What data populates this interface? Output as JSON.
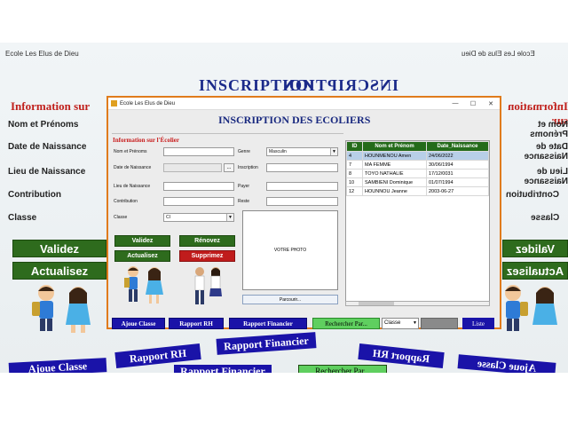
{
  "background": {
    "app_title": "Ecole Les Elus de Dieu",
    "heading": "INSCRIPTION",
    "info_heading": "Information sur",
    "labels": [
      "Nom et Prénoms",
      "Date de Naissance",
      "Lieu de Naissance",
      "Contribution",
      "Classe"
    ],
    "buttons": {
      "valider": "Validez",
      "actualiser": "Actualisez"
    },
    "bottom_buttons": [
      "Ajoue Classe",
      "Rapport RH",
      "Rapport Financier",
      "Rechercher Par...",
      "Classe"
    ]
  },
  "window": {
    "title": "Ecole Les Elus de Dieu",
    "controls": {
      "minimize": "—",
      "maximize": "☐",
      "close": "✕"
    },
    "heading": "INSCRIPTION DES ECOLIERS",
    "group_legend": "Information sur l'Écolier",
    "form": {
      "nom_label": "Nom et Prénoms",
      "nom_value": "",
      "date_label": "Date de Naissance",
      "date_value": "",
      "date_button": "...",
      "lieu_label": "Lieu de Naissance",
      "lieu_value": "",
      "contribution_label": "Contribution",
      "contribution_value": "",
      "classe_label": "Classe",
      "classe_value": "CI",
      "genre_label": "Genre",
      "genre_value": "Masculin",
      "inscription_label": "Inscription",
      "inscription_value": "",
      "payer_label": "Payer",
      "payer_value": "",
      "reste_label": "Reste",
      "reste_value": ""
    },
    "buttons": {
      "valider": "Validez",
      "renover": "Rénovez",
      "actualiser": "Actualisez",
      "supprimer": "Supprimez",
      "browse": "Parcourir..."
    },
    "photo_placeholder": "VOTRE PHOTO",
    "table": {
      "columns": [
        "ID",
        "Nom et Prénom",
        "Date_Naissance"
      ],
      "rows": [
        [
          "4",
          "HOUNMENOU Amen",
          "24/06/2022"
        ],
        [
          "7",
          "MA FEMME",
          "30/06/1994"
        ],
        [
          "8",
          "TOYO NATHALIE",
          "17/12/0031"
        ],
        [
          "10",
          "SAMBIENI Dominique",
          "01/07/1994"
        ],
        [
          "12",
          "HOUNNOU Jeanne",
          "2003-06-27"
        ]
      ],
      "selected_row": 0
    }
  },
  "bottom_bar": {
    "ajoute_classe": "Ajoue Classe",
    "rapport_rh": "Rapport RH",
    "rapport_financier": "Rapport Financier",
    "rechercher": "Rechercher Par...",
    "classe_select": "Classe",
    "liste": "Liste"
  },
  "colors": {
    "accent_blue": "#1a13a8",
    "green": "#2e6b1d",
    "red": "#c01c1c",
    "window_border": "#e07b1c"
  }
}
